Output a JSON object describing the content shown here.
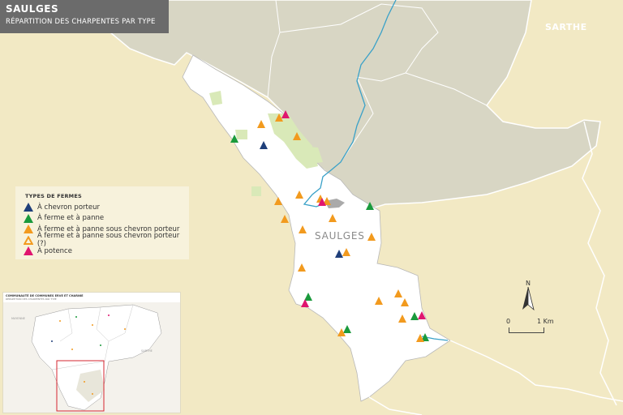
{
  "title": "SAULGES",
  "subtitle": "RÉPARTITION DES CHARPENTES PAR TYPE",
  "region_label": "SARTHE",
  "commune_label": "SAULGES",
  "legend": {
    "title": "TYPES DE FERMES",
    "items": [
      {
        "label": "À chevron porteur",
        "color": "#1f3f7a",
        "marker": "filled-triangle"
      },
      {
        "label": "À ferme et à panne",
        "color": "#1a9a3c",
        "marker": "filled-triangle"
      },
      {
        "label": "À ferme et à panne sous chevron porteur",
        "color": "#f29a1e",
        "marker": "filled-triangle"
      },
      {
        "label": "À ferme et à panne sous chevron porteur (?)",
        "color": "#f29a1e",
        "marker": "outline-triangle"
      },
      {
        "label": "À potence",
        "color": "#e0156f",
        "marker": "filled-triangle"
      }
    ]
  },
  "north_label": "N",
  "scale": {
    "start": "0",
    "end": "1 Km"
  },
  "inset": {
    "title": "COMMUNAUTÉ DE COMMUNES ERVE ET CHARNIE",
    "subtitle": "RÉPARTITION DES CHARPENTES PAR TYPE",
    "label_left": "MAYENNE",
    "label_right": "SARTHE"
  },
  "colors": {
    "background": "#f2e9c4",
    "neighbor_commune": "#d8d6c4",
    "commune": "#ffffff",
    "woodland": "#d9e9b8",
    "river": "#3aa1c8"
  }
}
